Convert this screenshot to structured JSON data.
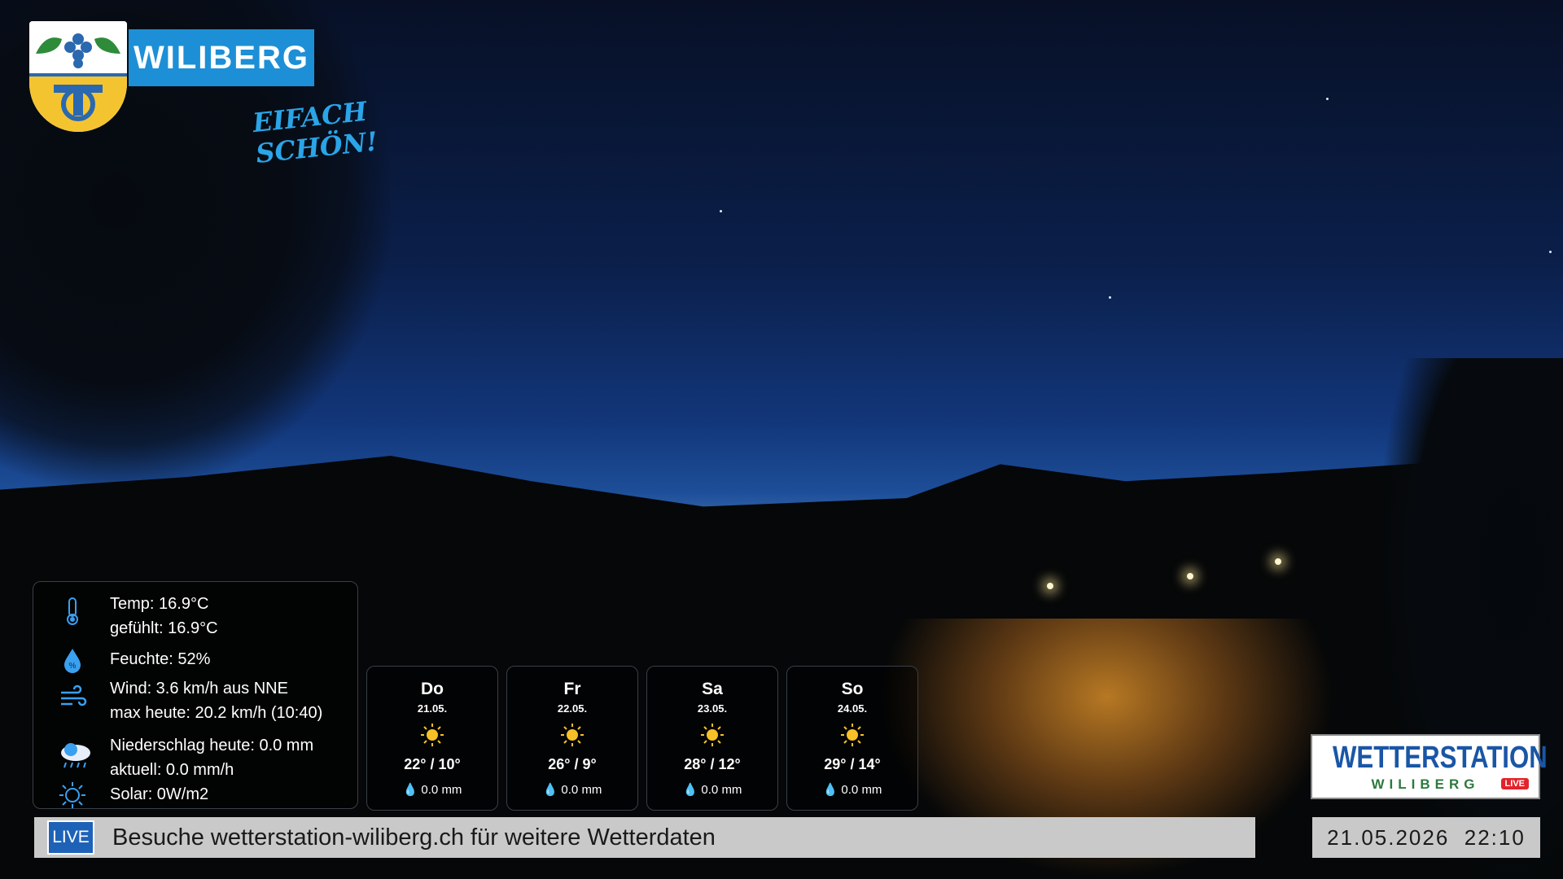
{
  "logo": {
    "name": "WILIBERG",
    "slogan": "EIFACH SCHÖN!"
  },
  "current": {
    "temp": "Temp: 16.9°C",
    "feels": "gefühlt: 16.9°C",
    "humidity": "Feuchte: 52%",
    "wind": "Wind: 3.6 km/h aus NNE",
    "wind_max": "max heute: 20.2 km/h (10:40)",
    "rain_today": "Niederschlag heute: 0.0 mm",
    "rain_now": "aktuell: 0.0 mm/h",
    "solar": "Solar: 0W/m2"
  },
  "forecast": [
    {
      "day": "Do",
      "date": "21.05.",
      "temp": "22° / 10°",
      "rain": "0.0 mm"
    },
    {
      "day": "Fr",
      "date": "22.05.",
      "temp": "26° / 9°",
      "rain": "0.0 mm"
    },
    {
      "day": "Sa",
      "date": "23.05.",
      "temp": "28° / 12°",
      "rain": "0.0 mm"
    },
    {
      "day": "So",
      "date": "24.05.",
      "temp": "29° / 14°",
      "rain": "0.0 mm"
    }
  ],
  "ticker": {
    "badge": "LIVE",
    "text": "Besuche wetterstation-wiliberg.ch für weitere Wetterdaten"
  },
  "brand": {
    "title": "WETTERSTATION",
    "subtitle": "WILIBERG",
    "live": "LIVE"
  },
  "datetime": "21.05.2026  22:10",
  "icons": {
    "temp": "thermometer-icon",
    "humidity": "humidity-drop-icon",
    "wind": "wind-icon",
    "rain": "rain-cloud-icon",
    "solar": "sun-outline-icon",
    "forecast": "sun-icon",
    "rain_drop": "drop-icon"
  },
  "colors": {
    "brand_blue": "#1a56a6",
    "logo_blue": "#1d8fd6",
    "live_red": "#e3232b",
    "sun_yellow": "#f6c026",
    "icon_blue": "#3aa0f0"
  }
}
